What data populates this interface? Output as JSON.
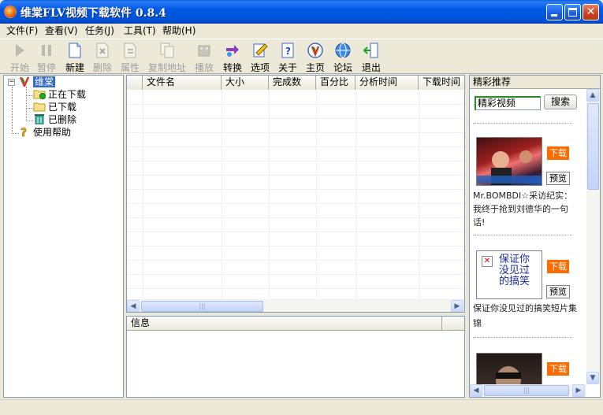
{
  "window": {
    "title": "维棠FLV视频下载软件 0.8.4"
  },
  "menu": [
    {
      "label": "文件(F)"
    },
    {
      "label": "查看(V)"
    },
    {
      "label": "任务(J)"
    },
    {
      "label": "工具(T)"
    },
    {
      "label": "帮助(H)"
    }
  ],
  "toolbar": {
    "start": "开始",
    "pause": "暂停",
    "new": "新建",
    "delete": "删除",
    "properties": "属性",
    "copy_url": "复制地址",
    "play": "播放",
    "convert": "转换",
    "options": "选项",
    "about": "关于",
    "homepage": "主页",
    "forum": "论坛",
    "exit": "退出"
  },
  "tree": {
    "root": "维棠",
    "downloading": "正在下载",
    "downloaded": "已下载",
    "deleted": "已删除",
    "help": "使用帮助"
  },
  "filelist": {
    "columns": [
      "文件名",
      "大小",
      "完成数",
      "百分比",
      "分析时间",
      "下载时间"
    ]
  },
  "info": {
    "header": "信息"
  },
  "recommend": {
    "title": "精彩推荐",
    "search_value": "精彩视频",
    "search_button": "搜索",
    "download_label": "下载",
    "preview_label": "预览",
    "items": [
      {
        "caption": "Mr.BOMBDI☆采访纪实：我终于抢到刘德华的一句话!"
      },
      {
        "caption": "保证你没见过的搞笑短片集锦",
        "thumb_text": "保证你没见过的搞笑"
      },
      {
        "caption": ""
      }
    ]
  },
  "colors": {
    "accent": "#0054e3",
    "download": "#ff6a00"
  }
}
